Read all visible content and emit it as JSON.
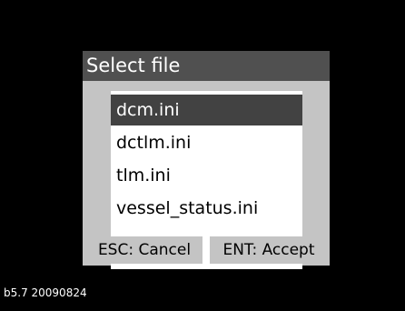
{
  "dialog": {
    "title": "Select file",
    "files": [
      "dcm.ini",
      "dctlm.ini",
      "tlm.ini",
      "vessel_status.ini"
    ],
    "selected_file": "dcm.ini",
    "buttons": {
      "cancel_label": "ESC: Cancel",
      "accept_label": "ENT: Accept"
    }
  },
  "version": "b5.7 20090824",
  "colors": {
    "background": "#000000",
    "dialog_bg": "#c4c4c4",
    "title_bar": "#505050",
    "selection": "#424242"
  }
}
